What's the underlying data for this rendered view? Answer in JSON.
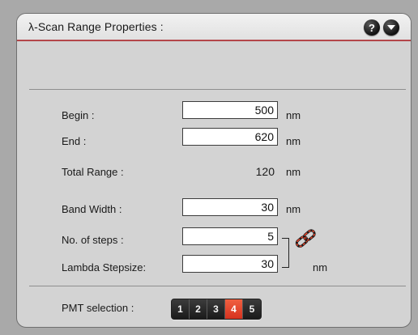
{
  "title": "λ-Scan Range Properties :",
  "titlebar": {
    "help_icon": "help-icon",
    "collapse_icon": "chevron-down-icon"
  },
  "fields": {
    "begin": {
      "label": "Begin :",
      "value": "500",
      "unit": "nm"
    },
    "end": {
      "label": "End :",
      "value": "620",
      "unit": "nm"
    },
    "total_range": {
      "label": "Total Range :",
      "value": "120",
      "unit": "nm"
    },
    "band_width": {
      "label": "Band Width :",
      "value": "30",
      "unit": "nm"
    },
    "num_steps": {
      "label": "No. of steps :",
      "value": "5"
    },
    "lambda_stepsize": {
      "label": "Lambda Stepsize:",
      "value": "30",
      "unit": "nm"
    }
  },
  "link_icon": "chain-link-icon",
  "pmt": {
    "label": "PMT selection :",
    "options": [
      "1",
      "2",
      "3",
      "4",
      "5"
    ],
    "selected": "4"
  },
  "colors": {
    "accent_line": "#b4464a",
    "pmt_active": "#e2452c"
  }
}
